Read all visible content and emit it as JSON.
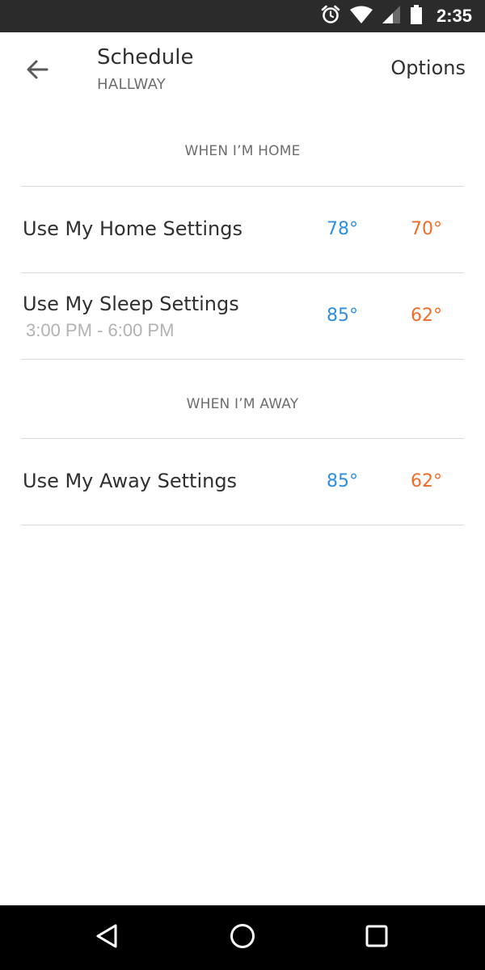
{
  "status_bar": {
    "time": "2:35",
    "icons": [
      "alarm-icon",
      "wifi-icon",
      "signal-icon",
      "battery-icon"
    ]
  },
  "header": {
    "back_icon": "arrow-left-icon",
    "title": "Schedule",
    "subtitle": "HALLWAY",
    "options_label": "Options"
  },
  "colors": {
    "cool": "#2f8fdd",
    "heat": "#ef6c2a"
  },
  "sections": {
    "home": {
      "header": "WHEN I’M HOME",
      "rows": [
        {
          "label": "Use My Home Settings",
          "time": "",
          "cool": "78°",
          "heat": "70°"
        },
        {
          "label": "Use My Sleep Settings",
          "time": "3:00 PM -  6:00 PM",
          "cool": "85°",
          "heat": "62°"
        }
      ]
    },
    "away": {
      "header": "WHEN I’M AWAY",
      "rows": [
        {
          "label": "Use My Away Settings",
          "time": "",
          "cool": "85°",
          "heat": "62°"
        }
      ]
    }
  },
  "nav_bar": {
    "icons": [
      "back-triangle-icon",
      "home-circle-icon",
      "recents-square-icon"
    ]
  }
}
